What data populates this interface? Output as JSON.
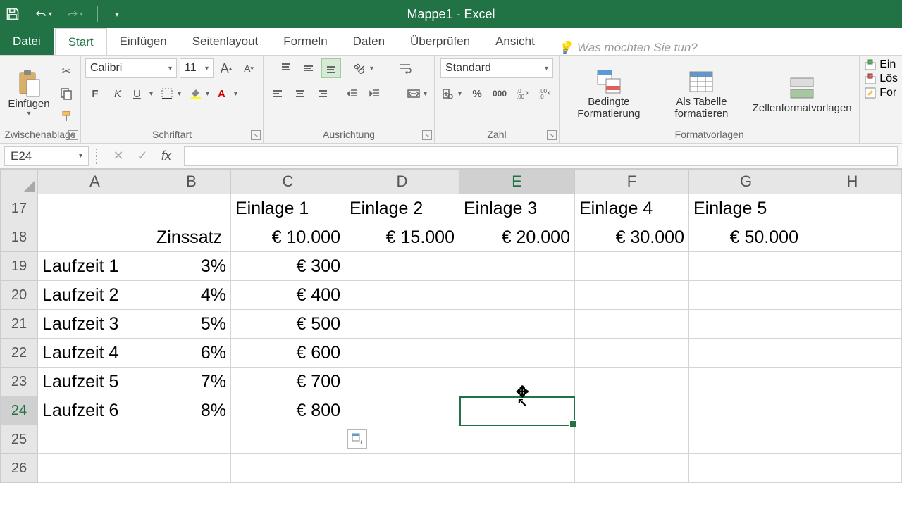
{
  "app_title": "Mappe1 - Excel",
  "tabs": {
    "datei": "Datei",
    "start": "Start",
    "einfuegen": "Einfügen",
    "seitenlayout": "Seitenlayout",
    "formeln": "Formeln",
    "daten": "Daten",
    "ueberpruefen": "Überprüfen",
    "ansicht": "Ansicht",
    "tell_me": "Was möchten Sie tun?"
  },
  "ribbon": {
    "clipboard": {
      "einfuegen": "Einfügen",
      "group": "Zwischenablage"
    },
    "font": {
      "name": "Calibri",
      "size": "11",
      "group": "Schriftart"
    },
    "alignment": {
      "group": "Ausrichtung"
    },
    "number": {
      "format": "Standard",
      "group": "Zahl"
    },
    "styles": {
      "conditional": "Bedingte Formatierung",
      "table": "Als Tabelle formatieren",
      "cell_styles": "Zellenformatvorlagen",
      "group": "Formatvorlagen"
    },
    "cells_partial": {
      "ein": "Ein",
      "los": "Lös",
      "for": "For"
    }
  },
  "name_box": "E24",
  "formula": "",
  "columns": [
    "A",
    "B",
    "C",
    "D",
    "E",
    "F",
    "G",
    "H"
  ],
  "row_numbers": [
    17,
    18,
    19,
    20,
    21,
    22,
    23,
    24,
    25,
    26
  ],
  "active_row": 24,
  "active_col": "E",
  "cells": {
    "17": {
      "C": "Einlage 1",
      "D": "Einlage 2",
      "E": "Einlage 3",
      "F": "Einlage 4",
      "G": "Einlage 5"
    },
    "18": {
      "B": "Zinssatz",
      "C": "€ 10.000",
      "D": "€ 15.000",
      "E": "€ 20.000",
      "F": "€ 30.000",
      "G": "€ 50.000"
    },
    "19": {
      "A": "Laufzeit 1",
      "B": "3%",
      "C": "€ 300"
    },
    "20": {
      "A": "Laufzeit 2",
      "B": "4%",
      "C": "€ 400"
    },
    "21": {
      "A": "Laufzeit 3",
      "B": "5%",
      "C": "€ 500"
    },
    "22": {
      "A": "Laufzeit 4",
      "B": "6%",
      "C": "€ 600"
    },
    "23": {
      "A": "Laufzeit 5",
      "B": "7%",
      "C": "€ 700"
    },
    "24": {
      "A": "Laufzeit 6",
      "B": "8%",
      "C": "€ 800"
    }
  }
}
